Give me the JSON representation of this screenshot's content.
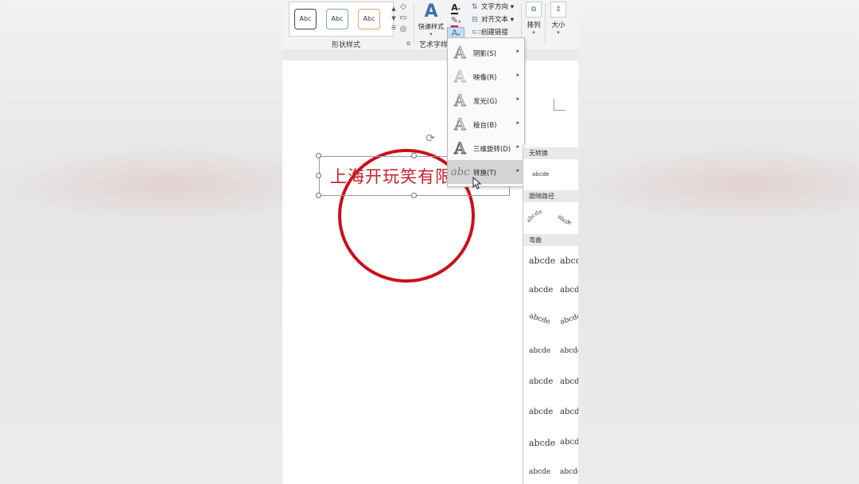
{
  "ribbon": {
    "shape_styles": {
      "group_label": "形状样式",
      "style_buttons": [
        "Abc",
        "Abc",
        "Abc"
      ]
    },
    "wordart": {
      "quick_style_label": "快速样式",
      "group_label": "艺术字样"
    },
    "text": {
      "direction_label": "文字方向",
      "align_label": "对齐文本",
      "link_label": "创建链接"
    },
    "arrange_label": "排列",
    "size_label": "大小"
  },
  "document": {
    "wordart_text": "上海开玩笑有限"
  },
  "text_effects_menu": {
    "items": [
      {
        "label": "阴影(S)"
      },
      {
        "label": "映像(R)"
      },
      {
        "label": "发光(G)"
      },
      {
        "label": "棱台(B)"
      },
      {
        "label": "三维旋转(D)"
      },
      {
        "label": "转换(T)",
        "highlighted": true
      }
    ]
  },
  "transform_submenu": {
    "no_transform_header": "无转换",
    "no_transform_sample": "abcde",
    "follow_path_header": "跟随路径",
    "follow_path_samples": [
      "abcde",
      "abcde"
    ],
    "warp_header": "弯曲",
    "warp_samples": [
      [
        "abcde",
        "abcde"
      ],
      [
        "abcde",
        "abcde"
      ],
      [
        "abcde",
        "abcde"
      ],
      [
        "abcde",
        "abcde"
      ],
      [
        "abcde",
        "abcde"
      ],
      [
        "abcde",
        "abcde"
      ],
      [
        "abcde",
        "abcde"
      ],
      [
        "abcde",
        "abcde"
      ]
    ]
  },
  "colors": {
    "accent": "#3d6fb0",
    "wordart_red": "#c8202a",
    "stamp_red": "#cc0e1a"
  }
}
